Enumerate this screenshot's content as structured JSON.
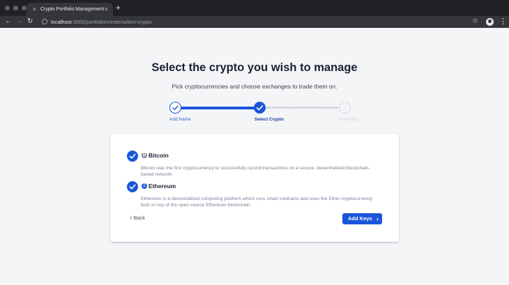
{
  "browser": {
    "tab_title": "Crypto Portfolio Management",
    "tab_close": "×",
    "new_tab": "+",
    "url_host": "localhost",
    "url_path": ":3000/portfolio/create/select-crypto",
    "back": "←",
    "forward": "→",
    "reload": "↻",
    "star": "☆",
    "menu": "⋮"
  },
  "page": {
    "title": "Select the crypto you wish to manage",
    "subtitle": "Pick cryptocurrencies and choose exchanges to trade them on."
  },
  "stepper": {
    "steps": [
      {
        "label": "Add Name",
        "status": "completed"
      },
      {
        "label": "Select Crypto",
        "status": "current"
      },
      {
        "label": "Add Keys",
        "status": "pending"
      }
    ]
  },
  "cryptos": [
    {
      "name": "Bitcoin",
      "symbol": "₿",
      "selected": true,
      "description": "Bitcoin was the first cryptocurrency to successfully record transactions on a secure, decentralized blockchain-based network."
    },
    {
      "name": "Ethereum",
      "symbol": "Ξ",
      "selected": true,
      "description": "Ethereum is a decentralized computing platform which runs smart contracts and uses the Ether cryptocurrency built on top of the open source Ethereum blockchain"
    }
  ],
  "actions": {
    "back_label": "Back",
    "back_chevron": "‹",
    "next_label": "Add Keys",
    "next_chevron": "›"
  },
  "colors": {
    "accent": "#1a56db",
    "heading": "#1e2133",
    "muted": "#7a7f95",
    "page_background": "#f4f5f7"
  }
}
